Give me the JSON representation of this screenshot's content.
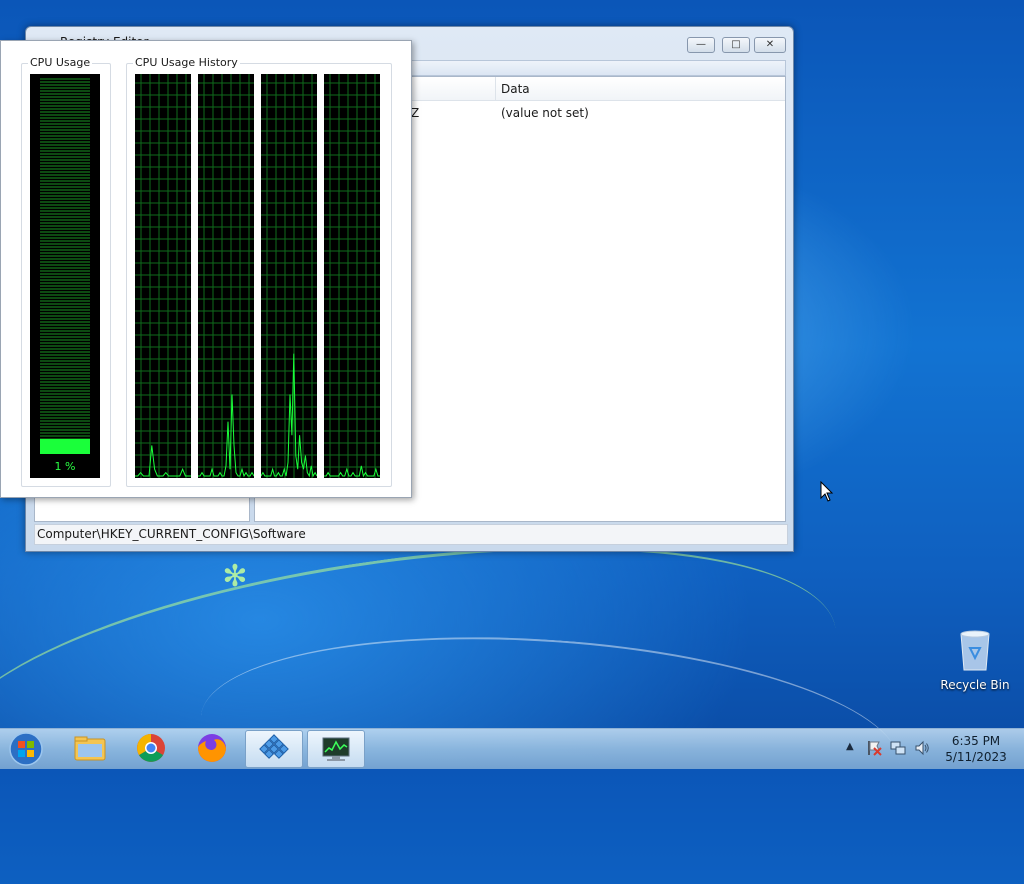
{
  "registry_editor": {
    "title": "Registry Editor",
    "minimize_glyph": "—",
    "maximize_glyph": "□",
    "close_glyph": "✕",
    "columns": {
      "data": "Data"
    },
    "rows": [
      {
        "type_fragment": "Z",
        "data": "(value not set)"
      }
    ],
    "status_path": "Computer\\HKEY_CURRENT_CONFIG\\Software"
  },
  "task_manager": {
    "cpu_usage_label": "CPU Usage",
    "cpu_history_label": "CPU Usage History",
    "cpu_percent_text": "1 %",
    "cpu_fraction": 0.01
  },
  "desktop": {
    "recycle_bin_label": "Recycle Bin"
  },
  "taskbar": {
    "apps": [
      {
        "name": "windows-explorer",
        "icon": "folder-icon"
      },
      {
        "name": "chrome",
        "icon": "chrome-icon"
      },
      {
        "name": "firefox",
        "icon": "firefox-icon"
      },
      {
        "name": "registry-editor",
        "icon": "registry-icon"
      },
      {
        "name": "task-manager",
        "icon": "task-manager-icon"
      }
    ],
    "tray_expand_glyph": "▲",
    "time": "6:35 PM",
    "date": "5/11/2023"
  },
  "colors": {
    "graph_green": "#1aff3a",
    "grid_green": "#0f6b1c",
    "desktop_blue": "#1273d2"
  }
}
